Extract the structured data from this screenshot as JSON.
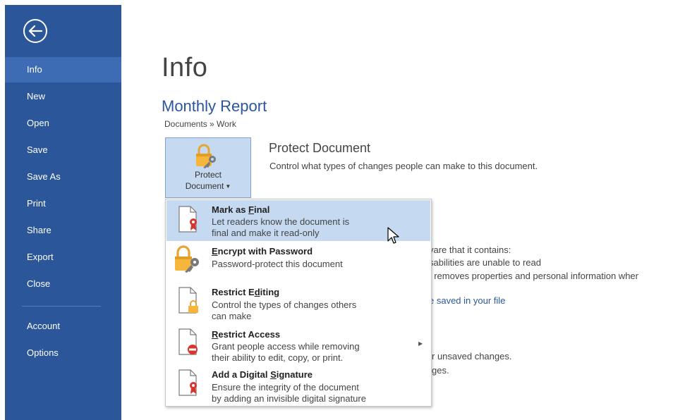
{
  "sidebar": {
    "back_label": "Back",
    "items": [
      {
        "label": "Info",
        "active": true
      },
      {
        "label": "New"
      },
      {
        "label": "Open"
      },
      {
        "label": "Save"
      },
      {
        "label": "Save As"
      },
      {
        "label": "Print"
      },
      {
        "label": "Share"
      },
      {
        "label": "Export"
      },
      {
        "label": "Close"
      },
      {
        "label": "Account"
      },
      {
        "label": "Options"
      }
    ]
  },
  "main": {
    "page_title": "Info",
    "doc_title": "Monthly Report",
    "breadcrumb": "Documents » Work",
    "protect_button": {
      "line1": "Protect",
      "line2": "Document"
    },
    "protect_section": {
      "title": "Protect Document",
      "description": "Control what types of changes people can make to this document."
    },
    "background_fragments": {
      "inspect_line1": "vare that it contains:",
      "inspect_line2": "sabilities are unable to read",
      "inspect_line3": "/ removes properties and personal information wher",
      "inspect_link": "e saved in your file",
      "versions_line1": "r unsaved changes.",
      "versions_line2": "ges."
    }
  },
  "protect_menu": {
    "items": [
      {
        "title_pre": "Mark as ",
        "title_u": "F",
        "title_post": "inal",
        "desc_line1": "Let readers know the document is",
        "desc_line2": "final and make it read-only",
        "icon": "mark-final-icon"
      },
      {
        "title_pre": "",
        "title_u": "E",
        "title_post": "ncrypt with Password",
        "desc_line1": "Password-protect this document",
        "desc_line2": "",
        "icon": "encrypt-lock-icon"
      },
      {
        "title_pre": "Restrict E",
        "title_u": "d",
        "title_post": "iting",
        "desc_line1": "Control the types of changes others",
        "desc_line2": "can make",
        "icon": "restrict-editing-icon"
      },
      {
        "title_pre": "",
        "title_u": "R",
        "title_post": "estrict Access",
        "desc_line1": "Grant people access while removing",
        "desc_line2": "their ability to edit, copy, or print.",
        "icon": "restrict-access-icon"
      },
      {
        "title_pre": "Add a Digital ",
        "title_u": "S",
        "title_post": "ignature",
        "desc_line1": "Ensure the integrity of the document",
        "desc_line2": "by adding an invisible digital signature",
        "icon": "digital-signature-icon"
      }
    ]
  },
  "colors": {
    "sidebar": "#2b579a",
    "sidebar_active": "#3d6cb5",
    "accent": "#2b579a",
    "menu_hover": "#c5d9f1"
  }
}
